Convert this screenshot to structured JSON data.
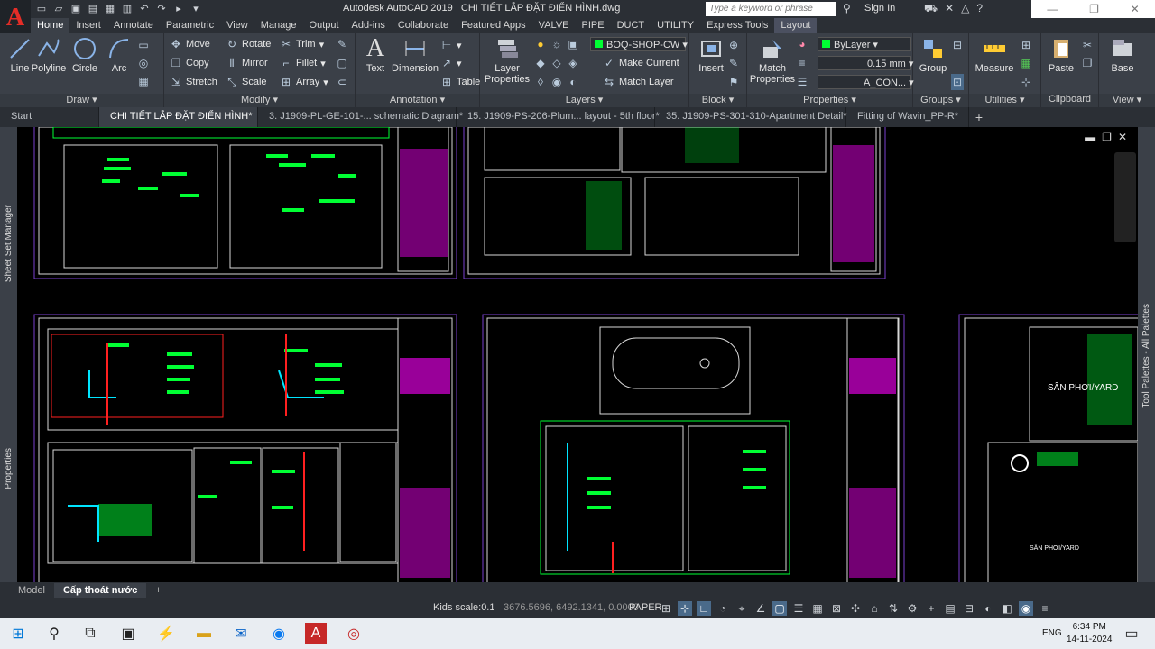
{
  "title_bar": {
    "app_name": "Autodesk AutoCAD 2019",
    "file_name": "CHI TIẾT LẮP ĐẶT ĐIỂN HÌNH.dwg",
    "search_placeholder": "Type a keyword or phrase",
    "sign_in": "Sign In"
  },
  "ribbon_tabs": [
    "Home",
    "Insert",
    "Annotate",
    "Parametric",
    "View",
    "Manage",
    "Output",
    "Add-ins",
    "Collaborate",
    "Featured Apps",
    "VALVE",
    "PIPE",
    "DUCT",
    "UTILITY",
    "Express Tools",
    "Layout"
  ],
  "ribbon": {
    "draw": {
      "title": "Draw",
      "line": "Line",
      "polyline": "Polyline",
      "circle": "Circle",
      "arc": "Arc"
    },
    "modify": {
      "title": "Modify",
      "move": "Move",
      "rotate": "Rotate",
      "trim": "Trim",
      "copy": "Copy",
      "mirror": "Mirror",
      "fillet": "Fillet",
      "stretch": "Stretch",
      "scale": "Scale",
      "array": "Array"
    },
    "annotation": {
      "title": "Annotation",
      "text": "Text",
      "dimension": "Dimension",
      "table": "Table"
    },
    "layers": {
      "title": "Layers",
      "layer_properties": "Layer Properties",
      "current_layer": "BOQ-SHOP-CW",
      "make_current": "Make Current",
      "match_layer": "Match Layer"
    },
    "block": {
      "title": "Block",
      "insert": "Insert"
    },
    "properties": {
      "title": "Properties",
      "match_properties": "Match Properties",
      "color": "ByLayer",
      "lineweight": "0.15 mm",
      "linetype": "A_CON..."
    },
    "groups": {
      "title": "Groups",
      "group": "Group"
    },
    "utilities": {
      "title": "Utilities",
      "measure": "Measure"
    },
    "clipboard": {
      "title": "Clipboard",
      "paste": "Paste"
    },
    "view": {
      "title": "View",
      "base": "Base"
    }
  },
  "doc_tabs": [
    "Start",
    "CHI TIẾT LẮP ĐẶT ĐIỂN HÌNH*",
    "3. J1909-PL-GE-101-... schematic Diagram*",
    "15. J1909-PS-206-Plum... layout - 5th floor*",
    "35. J1909-PS-301-310-Apartment Detail*",
    "Fitting of Wavin_PP-R*"
  ],
  "palettes": {
    "sheet_set": "Sheet Set Manager",
    "properties": "Properties",
    "tool_palettes": "Tool Palettes - All Palettes"
  },
  "drawing_labels": {
    "yard1": "SÂN PHƠI/YARD",
    "yard2": "SÂN PHƠI/YARD"
  },
  "layout_tabs": [
    "Model",
    "Cấp thoát nước"
  ],
  "status_bar": {
    "scale": "Kids scale:0.1",
    "coords": "3676.5696, 6492.1341, 0.0000",
    "space": "PAPER"
  },
  "taskbar": {
    "lang": "ENG",
    "time": "6:34 PM",
    "date": "14-11-2024"
  },
  "colors": {
    "accent_green": "#00ff33",
    "magenta": "#ff00ff",
    "frame": "#6a3aa8"
  }
}
